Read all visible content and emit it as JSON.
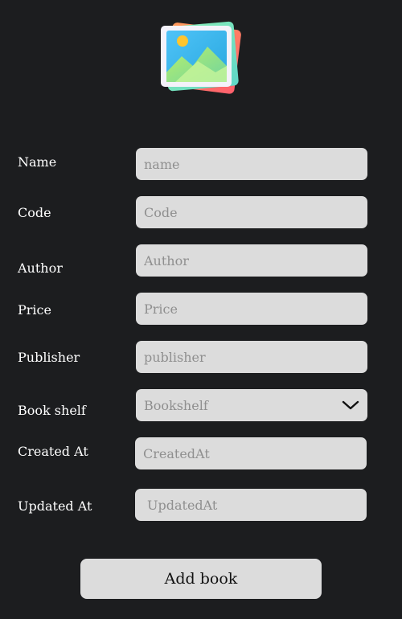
{
  "form": {
    "fields": [
      {
        "label": "Name",
        "placeholder": "name"
      },
      {
        "label": "Code",
        "placeholder": "Code"
      },
      {
        "label": "Author",
        "placeholder": "Author"
      },
      {
        "label": "Price",
        "placeholder": "Price"
      },
      {
        "label": "Publisher",
        "placeholder": "publisher"
      },
      {
        "label": "Book shelf",
        "placeholder": "Bookshelf"
      },
      {
        "label": "Created At",
        "placeholder": "CreatedAt"
      },
      {
        "label": "Updated At",
        "placeholder": "UpdatedAt"
      }
    ],
    "submit_label": "Add book"
  },
  "icons": {
    "logo": "image-gallery-icon",
    "select_arrow": "chevron-down-icon"
  },
  "colors": {
    "background": "#1c1d1f",
    "field_background": "#dcdcdc",
    "placeholder": "#8f8f8f",
    "label": "#ffffff"
  }
}
